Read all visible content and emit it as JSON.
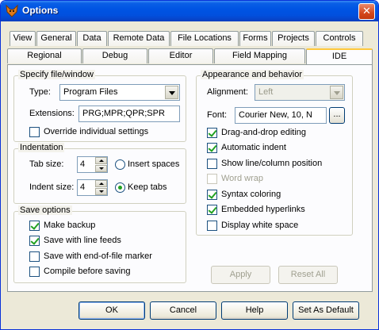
{
  "window": {
    "title": "Options",
    "close_label": "✕"
  },
  "tabs_row1": [
    "View",
    "General",
    "Data",
    "Remote Data",
    "File Locations",
    "Forms",
    "Projects",
    "Controls"
  ],
  "tabs_row2": [
    "Regional",
    "Debug",
    "Editor",
    "Field Mapping",
    "IDE"
  ],
  "active_tab": "IDE",
  "specify": {
    "group_label": "Specify file/window",
    "type_label": "Type:",
    "type_value": "Program Files",
    "extensions_label": "Extensions:",
    "extensions_value": "PRG;MPR;QPR;SPR",
    "override_label": "Override individual settings",
    "override_checked": false
  },
  "indentation": {
    "group_label": "Indentation",
    "tab_size_label": "Tab size:",
    "tab_size_value": "4",
    "indent_size_label": "Indent size:",
    "indent_size_value": "4",
    "insert_spaces_label": "Insert spaces",
    "keep_tabs_label": "Keep tabs",
    "selected": "keep_tabs"
  },
  "save_options": {
    "group_label": "Save options",
    "items": [
      {
        "label": "Make backup",
        "checked": true
      },
      {
        "label": "Save with line feeds",
        "checked": true
      },
      {
        "label": "Save with end-of-file marker",
        "checked": false
      },
      {
        "label": "Compile before saving",
        "checked": false
      }
    ]
  },
  "appearance": {
    "group_label": "Appearance and behavior",
    "alignment_label": "Alignment:",
    "alignment_value": "Left",
    "font_label": "Font:",
    "font_value": "Courier New, 10, N",
    "font_button": "...",
    "items": [
      {
        "label": "Drag-and-drop editing",
        "checked": true,
        "enabled": true
      },
      {
        "label": "Automatic indent",
        "checked": true,
        "enabled": true
      },
      {
        "label": "Show line/column position",
        "checked": false,
        "enabled": true
      },
      {
        "label": "Word wrap",
        "checked": false,
        "enabled": false
      },
      {
        "label": "Syntax coloring",
        "checked": true,
        "enabled": true
      },
      {
        "label": "Embedded hyperlinks",
        "checked": true,
        "enabled": true
      },
      {
        "label": "Display white space",
        "checked": false,
        "enabled": true
      }
    ]
  },
  "panel_buttons": {
    "apply": "Apply",
    "reset_all": "Reset All"
  },
  "dialog_buttons": {
    "ok": "OK",
    "cancel": "Cancel",
    "help": "Help",
    "set_default": "Set As Default"
  }
}
